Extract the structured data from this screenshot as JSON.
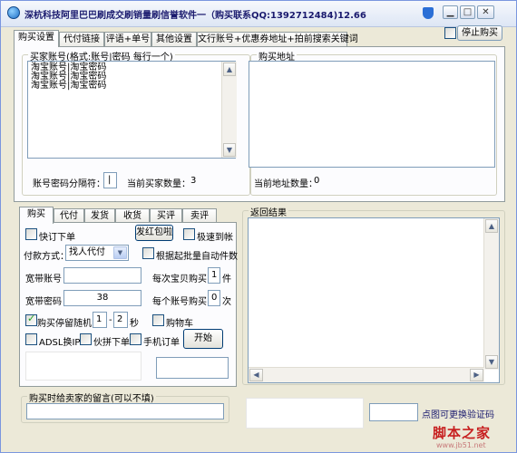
{
  "window": {
    "title": "深杭科技阿里巴巴刷成交刷销量刷信誉软件一（购买联系QQ:1392712484)12.66",
    "min_glyph": "▁",
    "max_glyph": "□",
    "close_glyph": "✕"
  },
  "top_tabs": [
    "购买设置",
    "代付链接",
    "评语+单号",
    "其他设置",
    "文行账号+优惠券地址+拍前搜索关键词"
  ],
  "stop_buy": {
    "label": "停止购买",
    "checked": false
  },
  "accounts": {
    "group_label": "买家账号(格式:账号|密码 每行一个)",
    "lines": "淘宝账号|淘宝密码\n淘宝账号|淘宝密码\n淘宝账号|淘宝密码",
    "separator_label": "账号密码分隔符：",
    "separator_value": "|",
    "count_label": "当前买家数量：",
    "count_value": "3"
  },
  "addresses": {
    "group_label": "购买地址",
    "count_label": "当前地址数量：",
    "count_value": "0"
  },
  "lower_tabs": [
    "购买",
    "代付",
    "发货",
    "收货",
    "买评",
    "卖评"
  ],
  "buy_panel": {
    "fast_order": "快订下单",
    "red_packet_btn": "发红包啦",
    "fast_receive": "极速到帐",
    "pay_method_label": "付款方式：",
    "pay_method_value": "找人代付",
    "auto_pay": "根据起批量自动件数",
    "broadband_account_label": "宽带账号",
    "broadband_account_value": "",
    "per_buy_label": "每次宝贝购买",
    "per_buy_value": "1",
    "per_buy_unit": "件",
    "broadband_pwd_label": "宽带密码",
    "broadband_pwd_value": "38",
    "per_account_label": "每个账号购买",
    "per_account_value": "0",
    "per_account_unit": "次",
    "random_stay_label": "购买停留随机",
    "random_from": "1",
    "random_dash": "-",
    "random_to": "2",
    "random_unit": "秒",
    "cart": "购物车",
    "adsl": "ADSL换IP",
    "group_order": "伙拼下单",
    "mobile_order": "手机订单",
    "start_btn": "开始"
  },
  "result": {
    "group_label": "返回结果"
  },
  "message": {
    "label": "购买时给卖家的留言(可以不填)",
    "value": ""
  },
  "captcha": {
    "hint": "点图可更换验证码",
    "value": ""
  },
  "watermark": {
    "text": "脚本之家",
    "url": "www.jb51.net"
  }
}
